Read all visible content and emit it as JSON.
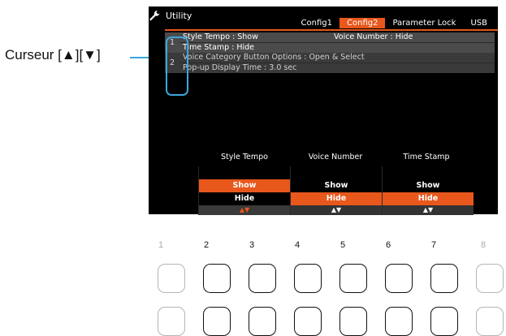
{
  "callout": {
    "label": "Curseur [▲][▼]"
  },
  "screen": {
    "title": "Utility",
    "tabs": [
      {
        "label": "Config1",
        "active": false
      },
      {
        "label": "Config2",
        "active": true
      },
      {
        "label": "Parameter Lock",
        "active": false
      },
      {
        "label": "USB",
        "active": false
      }
    ],
    "rows": [
      {
        "num": "1",
        "line1_left": "Style Tempo : Show",
        "line1_right": "Voice Number : Hide",
        "line2_left": "Time Stamp : Hide"
      },
      {
        "num": "2",
        "line1_left": "Voice Category Button Options : Open & Select",
        "line2_left": "Pop-up Display Time : 3.0 sec"
      }
    ],
    "params": [
      {
        "header": "Style Tempo",
        "options": [
          "Show",
          "Hide"
        ],
        "selected": 0,
        "arrows": "▲▼"
      },
      {
        "header": "Voice Number",
        "options": [
          "Show",
          "Hide"
        ],
        "selected": 1,
        "arrows": "▲▼"
      },
      {
        "header": "Time Stamp",
        "options": [
          "Show",
          "Hide"
        ],
        "selected": 1,
        "arrows": "▲▼"
      }
    ]
  },
  "buttons": {
    "numbers": [
      "1",
      "2",
      "3",
      "4",
      "5",
      "6",
      "7",
      "8"
    ]
  },
  "colors": {
    "accent": "#e8571c",
    "callout": "#3aa6dd"
  }
}
